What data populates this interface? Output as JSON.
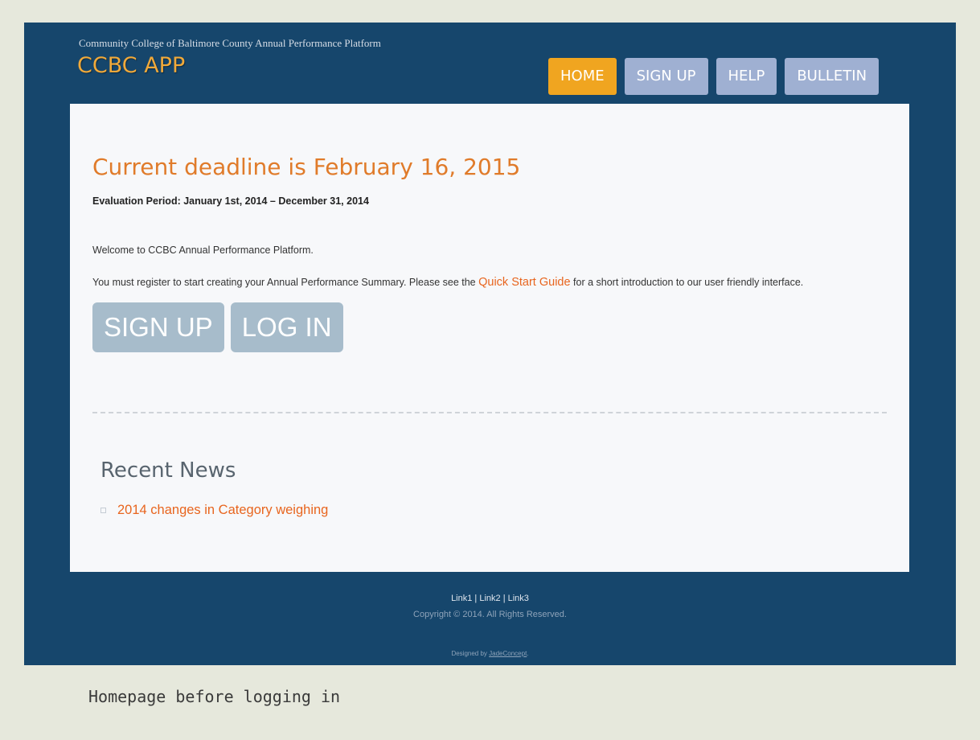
{
  "header": {
    "tagline": "Community College of Baltimore County Annual Performance Platform",
    "logo": "CCBC APP"
  },
  "nav": [
    {
      "label": "HOME",
      "active": true
    },
    {
      "label": "SIGN UP",
      "active": false
    },
    {
      "label": "HELP",
      "active": false
    },
    {
      "label": "BULLETIN",
      "active": false
    }
  ],
  "main": {
    "deadline_heading": "Current deadline is February 16, 2015",
    "evaluation_period": "Evaluation Period: January 1st, 2014 – December 31, 2014",
    "welcome_text": "Welcome to CCBC Annual Performance Platform.",
    "register_text_before": "You must register to start creating your Annual Performance Summary. Please see the ",
    "quick_start_link": "Quick Start Guide",
    "register_text_after": " for a short introduction to our user friendly interface.",
    "signup_button": "SIGN UP",
    "login_button": "LOG IN"
  },
  "news": {
    "title": "Recent News",
    "items": [
      "2014 changes in Category weighing"
    ]
  },
  "footer": {
    "links": [
      "Link1",
      "Link2",
      "Link3"
    ],
    "separator": " | ",
    "copyright": "Copyright © 2014. All Rights Reserved.",
    "designed_by_prefix": "Designed by ",
    "designer": "JadeConcept",
    "designed_by_suffix": "."
  },
  "caption": "Homepage before logging in",
  "colors": {
    "page_bg": "#e6e8dc",
    "site_bg": "#16466c",
    "accent_orange": "#f0a520",
    "nav_button": "#9fb0d2",
    "link_orange": "#e8651e",
    "cta_button": "#a7bccb"
  }
}
